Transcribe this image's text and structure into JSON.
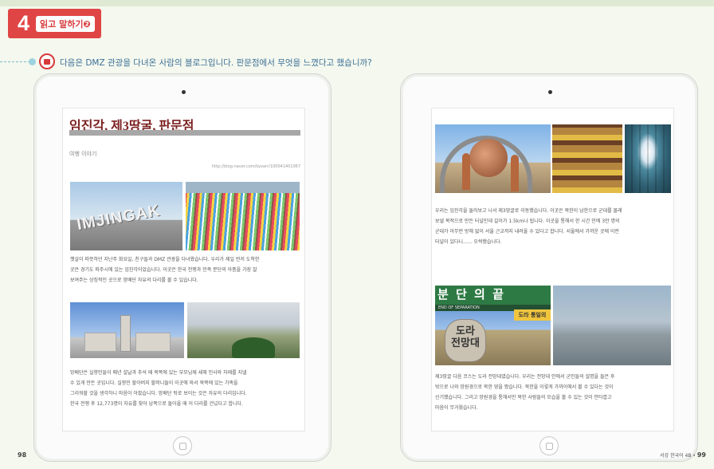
{
  "section": {
    "number": "4",
    "label": "읽고 말하기❷"
  },
  "question": "다음은 DMZ 관광을 다녀온 사람의 블로그입니다. 판문점에서 무엇을 느꼈다고 했습니까?",
  "left_tablet": {
    "blog_title": "임진각, 제3땅굴, 판문점",
    "category": "여행 이야기",
    "url": "http://blog.naver.com/kyoarr/100041401067",
    "photo_text": "IMJINGAK",
    "paragraph_1": [
      "햇살이 따뜻하던 지난주 화요일, 친구들과 DMZ 관광을 다녀왔습니다. 우리가 제일 먼저 도착한",
      "곳은 경기도 파주시에 있는 임진각이었습니다. 이곳은 한국 전쟁과 민족 분단의 아픔을 가장 잘",
      "보여주는 상징적인 곳으로 망배단 자유의 다리를 볼 수 있습니다."
    ],
    "paragraph_2": [
      "망배단은 실향민들이 매년 설날과 추석 때 북쪽에 있는 부모님께 새해 인사와 차례를 지낼",
      "수 있게 만든 곳입니다. 실향민 할아버지 할머니들이 이곳에 와서 북쪽에 있는 가족을",
      "그리워할 것을 생각하니 마음이 아팠습니다. 망배단 뒤로 보이는 것은 자유의 다리입니다.",
      "한국 전쟁 후 12,773명이 자유를 찾아 남쪽으로 돌아올 때 이 다리를 건넜다고 합니다."
    ]
  },
  "right_tablet": {
    "paragraph_1": [
      "우리는 임진각을 둘러보고 나서 제3땅굴로 이동했습니다. 이곳은 북한이 남한으로 군대를 몰래",
      "보낼 목적으로 만든 터널인데 길이가 1.5km나 됩니다. 이곳을 통해서 한 시간 안에 3만 명의",
      "군대가 아무런 방해 없이 서울 근교까지 내려올 수 있다고 합니다. 서울에서 가까운 곳에 이런",
      "터널이 있다니...... 오싹했습니다."
    ],
    "paragraph_2": [
      "제3땅굴 다음 코스는 도라 전망대였습니다. 우리는 전망대 안에서 군인들의 설명을 들은 후",
      "밖으로 나와 망원경으로 북한 땅을 봤습니다. 북한을 이렇게 가까이에서 볼 수 있다는 것이",
      "신기했습니다. 그리고 망원경을 통해서만 북한 사람들의 모습을 볼 수 있는 것이 안타깝고",
      "마음이 무거웠습니다."
    ],
    "banner_text": "분 단 의 끝",
    "banner_sub": "END OF SEPARATION",
    "sign_text": "도라 통일의",
    "stone_text": "도라\n전망대"
  },
  "footer": {
    "left_page": "98",
    "right_book": "서강 한국어 4B",
    "right_page": "99"
  }
}
